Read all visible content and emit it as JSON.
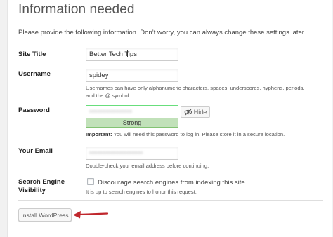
{
  "page": {
    "title": "Information needed",
    "intro": "Please provide the following information. Don’t worry, you can always change these settings later."
  },
  "site_title": {
    "label": "Site Title",
    "value": "Better Tech Tips"
  },
  "username": {
    "label": "Username",
    "value": "spidey",
    "hint": "Usernames can have only alphanumeric characters, spaces, underscores, hyphens, periods, and the @ symbol."
  },
  "password": {
    "label": "Password",
    "value": "••••••••••••••••",
    "strength": "Strong",
    "hide_label": "Hide",
    "hint_strong": "Important:",
    "hint_rest": " You will need this password to log in. Please store it in a secure location."
  },
  "email": {
    "label": "Your Email",
    "value": "••••••••••••••••••••",
    "hint": "Double-check your email address before continuing."
  },
  "search_engine": {
    "label_line1": "Search Engine",
    "label_line2": "Visibility",
    "checkbox_label": "Discourage search engines from indexing this site",
    "checked": false,
    "hint": "It is up to search engines to honor this request."
  },
  "install_button": {
    "label": "Install WordPress"
  },
  "colors": {
    "accent_arrow": "#c0272d",
    "strength_bg": "#c1e1b9",
    "strength_border": "#83c373"
  }
}
